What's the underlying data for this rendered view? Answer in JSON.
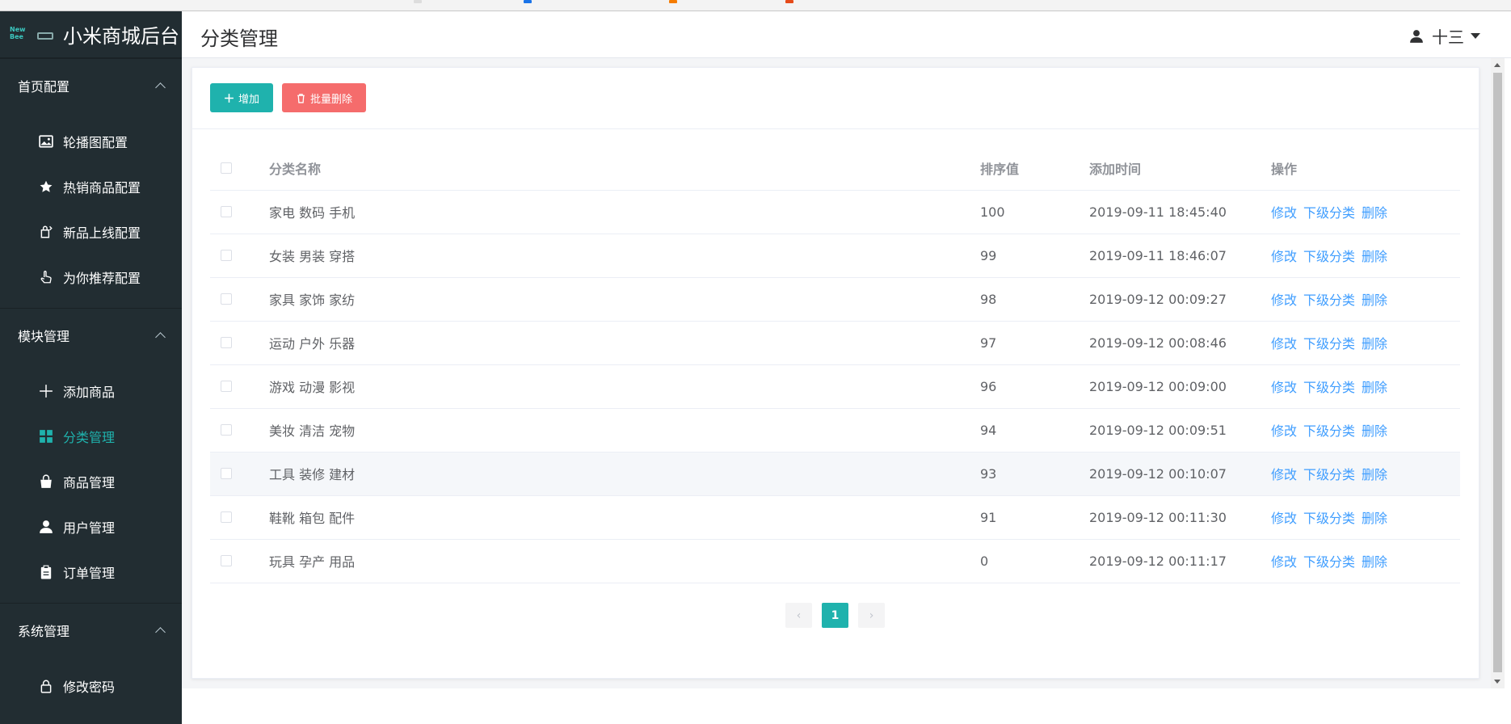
{
  "app": {
    "title": "小米商城后台",
    "logo_text": "New\nBee"
  },
  "sidebar": {
    "groups": [
      {
        "label": "首页配置",
        "items": [
          {
            "label": "轮播图配置",
            "icon": "image-icon"
          },
          {
            "label": "热销商品配置",
            "icon": "star-icon"
          },
          {
            "label": "新品上线配置",
            "icon": "new-product-icon"
          },
          {
            "label": "为你推荐配置",
            "icon": "hand-pointer-icon"
          }
        ]
      },
      {
        "label": "模块管理",
        "items": [
          {
            "label": "添加商品",
            "icon": "plus-icon"
          },
          {
            "label": "分类管理",
            "icon": "grid-icon",
            "active": true
          },
          {
            "label": "商品管理",
            "icon": "shopping-bag-icon"
          },
          {
            "label": "用户管理",
            "icon": "user-icon"
          },
          {
            "label": "订单管理",
            "icon": "clipboard-icon"
          }
        ]
      },
      {
        "label": "系统管理",
        "items": [
          {
            "label": "修改密码",
            "icon": "lock-icon"
          }
        ]
      }
    ]
  },
  "header": {
    "page_title": "分类管理",
    "user_name": "十三"
  },
  "toolbar": {
    "add_label": "增加",
    "batch_delete_label": "批量删除"
  },
  "table": {
    "columns": [
      "分类名称",
      "排序值",
      "添加时间",
      "操作"
    ],
    "actions": {
      "edit": "修改",
      "sub": "下级分类",
      "delete": "删除"
    },
    "rows": [
      {
        "name": "家电 数码 手机",
        "sort": "100",
        "time": "2019-09-11 18:45:40"
      },
      {
        "name": "女装 男装 穿搭",
        "sort": "99",
        "time": "2019-09-11 18:46:07"
      },
      {
        "name": "家具 家饰 家纺",
        "sort": "98",
        "time": "2019-09-12 00:09:27"
      },
      {
        "name": "运动 户外 乐器",
        "sort": "97",
        "time": "2019-09-12 00:08:46"
      },
      {
        "name": "游戏 动漫 影视",
        "sort": "96",
        "time": "2019-09-12 00:09:00"
      },
      {
        "name": "美妆 清洁 宠物",
        "sort": "94",
        "time": "2019-09-12 00:09:51"
      },
      {
        "name": "工具 装修 建材",
        "sort": "93",
        "time": "2019-09-12 00:10:07"
      },
      {
        "name": "鞋靴 箱包 配件",
        "sort": "91",
        "time": "2019-09-12 00:11:30"
      },
      {
        "name": "玩具 孕产 用品",
        "sort": "0",
        "time": "2019-09-12 00:11:17"
      }
    ]
  },
  "pagination": {
    "current_page": "1",
    "prev": "‹",
    "next": "›"
  },
  "colors": {
    "sidebar_bg": "#222d32",
    "accent": "#1fb2ad",
    "danger": "#f56c6c",
    "link": "#409eff"
  }
}
